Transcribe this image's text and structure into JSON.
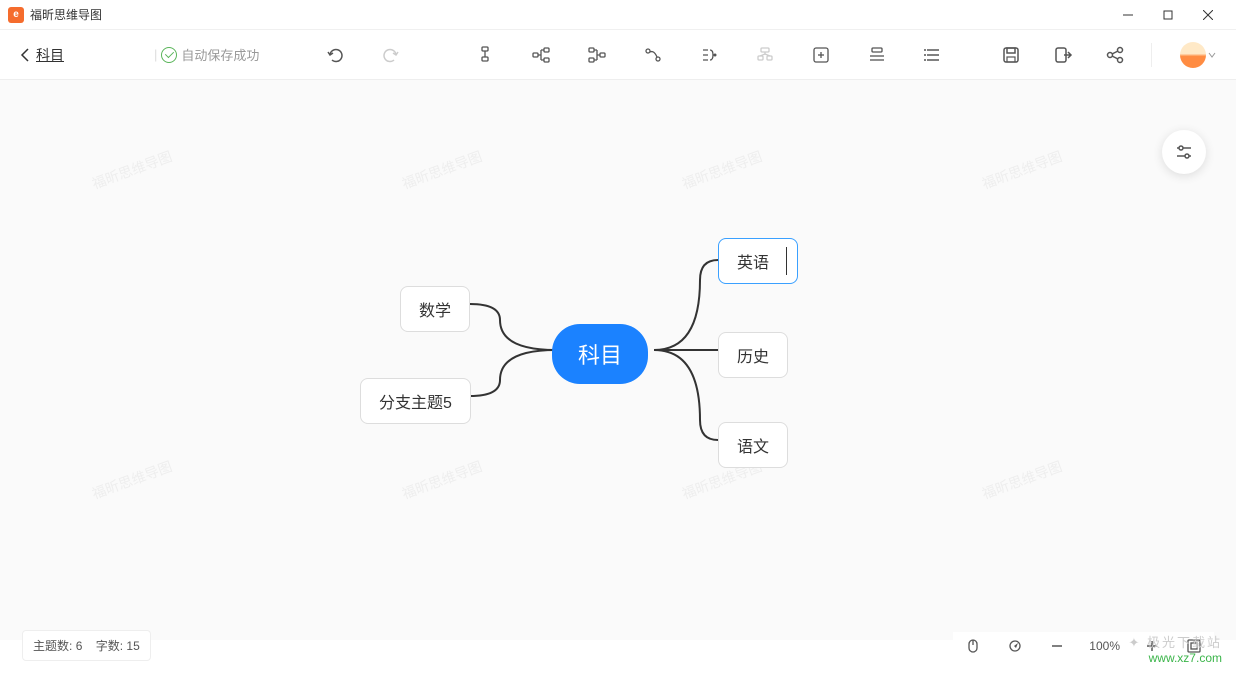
{
  "app": {
    "title": "福昕思维导图"
  },
  "header": {
    "back_label": "科目",
    "autosave_label": "自动保存成功"
  },
  "mindmap": {
    "root": "科目",
    "left_nodes": [
      "数学",
      "分支主题5"
    ],
    "right_nodes": [
      "英语",
      "历史",
      "语文"
    ],
    "selected_node": "英语"
  },
  "watermark_text": "福昕思维导图",
  "status": {
    "topic_label": "主题数:",
    "topic_count": "6",
    "word_label": "字数:",
    "word_count": "15",
    "zoom": "100%"
  },
  "site": {
    "name": "极光下载站",
    "url": "www.xz7.com"
  }
}
